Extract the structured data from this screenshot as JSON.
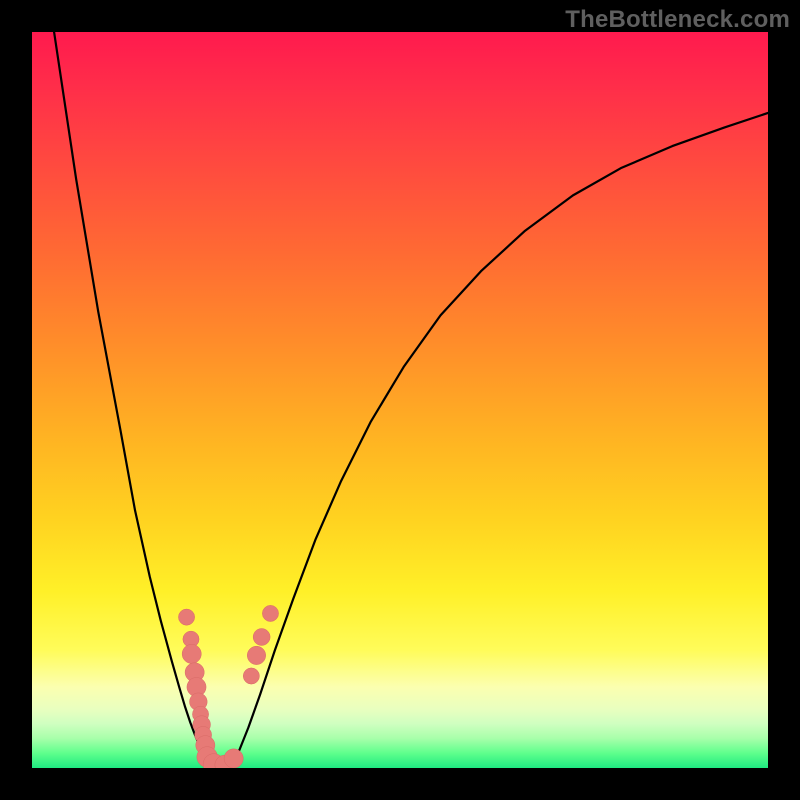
{
  "watermark": "TheBottleneck.com",
  "colors": {
    "curve": "#000000",
    "dot_fill": "#e77a76",
    "dot_stroke": "#d96a66"
  },
  "chart_data": {
    "type": "line",
    "title": "",
    "xlabel": "",
    "ylabel": "",
    "xlim": [
      0,
      100
    ],
    "ylim": [
      0,
      100
    ],
    "grid": false,
    "legend": false,
    "series": [
      {
        "name": "left-curve",
        "x": [
          3,
          6,
          9,
          12,
          14,
          16,
          17.5,
          19,
          20,
          20.8,
          21.5,
          22.1,
          22.6,
          23.0,
          23.3,
          23.6,
          23.8
        ],
        "y": [
          100,
          80,
          62,
          46,
          35,
          26,
          20,
          14.5,
          11,
          8.3,
          6.2,
          4.6,
          3.4,
          2.5,
          1.8,
          1.2,
          0.6
        ]
      },
      {
        "name": "valley-floor",
        "x": [
          23.8,
          24.5,
          25.3,
          26.2,
          27.2
        ],
        "y": [
          0.6,
          0.25,
          0.15,
          0.2,
          0.55
        ]
      },
      {
        "name": "right-curve",
        "x": [
          27.2,
          28.2,
          29.4,
          31.0,
          33.0,
          35.5,
          38.5,
          42.0,
          46.0,
          50.5,
          55.5,
          61.0,
          67.0,
          73.5,
          80.0,
          87.0,
          94.0,
          100.0
        ],
        "y": [
          0.55,
          2.5,
          5.5,
          10.0,
          16.0,
          23.0,
          31.0,
          39.0,
          47.0,
          54.5,
          61.5,
          67.5,
          73.0,
          77.8,
          81.5,
          84.5,
          87.0,
          89.0
        ]
      }
    ],
    "dot_groups": [
      {
        "name": "left-dots",
        "points": [
          {
            "x": 21.0,
            "y": 20.5,
            "r": 1.1
          },
          {
            "x": 21.6,
            "y": 17.5,
            "r": 1.1
          },
          {
            "x": 21.7,
            "y": 15.5,
            "r": 1.3
          },
          {
            "x": 22.1,
            "y": 13.0,
            "r": 1.3
          },
          {
            "x": 22.35,
            "y": 11.0,
            "r": 1.3
          },
          {
            "x": 22.6,
            "y": 9.0,
            "r": 1.2
          },
          {
            "x": 22.9,
            "y": 7.3,
            "r": 1.1
          },
          {
            "x": 23.05,
            "y": 5.9,
            "r": 1.2
          },
          {
            "x": 23.25,
            "y": 4.5,
            "r": 1.15
          },
          {
            "x": 23.55,
            "y": 3.1,
            "r": 1.3
          },
          {
            "x": 23.8,
            "y": 1.5,
            "r": 1.4
          },
          {
            "x": 24.7,
            "y": 0.5,
            "r": 1.45
          },
          {
            "x": 26.2,
            "y": 0.4,
            "r": 1.35
          },
          {
            "x": 27.4,
            "y": 1.3,
            "r": 1.3
          }
        ]
      },
      {
        "name": "right-dots",
        "points": [
          {
            "x": 29.8,
            "y": 12.5,
            "r": 1.1
          },
          {
            "x": 30.5,
            "y": 15.3,
            "r": 1.25
          },
          {
            "x": 31.2,
            "y": 17.8,
            "r": 1.15
          },
          {
            "x": 32.4,
            "y": 21.0,
            "r": 1.1
          }
        ]
      }
    ]
  }
}
